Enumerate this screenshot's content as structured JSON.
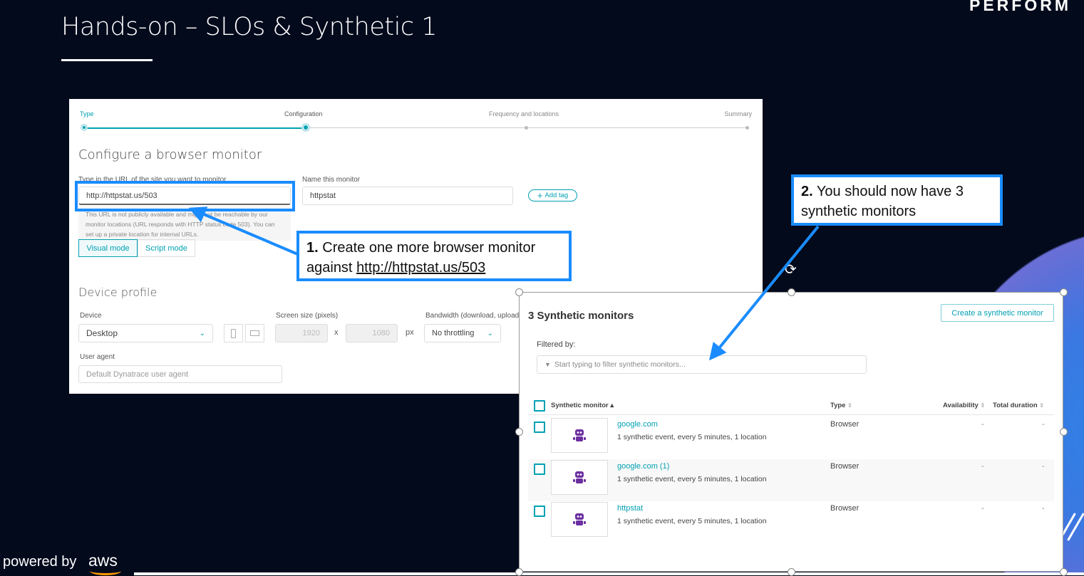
{
  "slide": {
    "title": "Hands-on – SLOs & Synthetic 1",
    "brand": "PERFORM",
    "powered_by": "powered by",
    "aws": "aws"
  },
  "wizard": {
    "steps": [
      {
        "label": "Type",
        "state": "done"
      },
      {
        "label": "Configuration",
        "state": "current"
      },
      {
        "label": "Frequency and locations",
        "state": "pending"
      },
      {
        "label": "Summary",
        "state": "pending"
      }
    ],
    "heading": "Configure a browser monitor",
    "url_label": "Type in the URL of the site you want to monitor",
    "url_value": "http://httpstat.us/503",
    "url_warning": "This URL is not publicly available and might not be reachable by our monitor locations (URL responds with HTTP status code 503). You can set up a private location for internal URLs.",
    "name_label": "Name this monitor",
    "name_value": "httpstat",
    "add_tag": "Add tag",
    "modes": [
      "Visual mode",
      "Script mode"
    ],
    "device_heading": "Device profile",
    "device_label": "Device",
    "device_value": "Desktop",
    "screen_label": "Screen size (pixels)",
    "screen_width": "1920",
    "screen_x": "x",
    "screen_height": "1080",
    "screen_unit": "px",
    "bandwidth_label": "Bandwidth (download, upload",
    "bandwidth_value": "No throttling",
    "ua_label": "User agent",
    "ua_placeholder": "Default Dynatrace user agent"
  },
  "callouts": {
    "one_num": "1.",
    "one_text": "Create one more browser monitor against",
    "one_link": "http://httpstat.us/503",
    "two_num": "2.",
    "two_text": "You should now have 3 synthetic monitors"
  },
  "monitors": {
    "title": "3 Synthetic monitors",
    "create_button": "Create a synthetic monitor",
    "filter_label": "Filtered by:",
    "filter_placeholder": "Start typing to filter synthetic monitors...",
    "columns": [
      "Synthetic monitor ▴",
      "Type",
      "Availability",
      "Total duration"
    ],
    "rows": [
      {
        "name": "google.com",
        "desc": "1 synthetic event, every 5 minutes, 1 location",
        "type": "Browser",
        "availability": "-",
        "duration": "-"
      },
      {
        "name": "google.com (1)",
        "desc": "1 synthetic event, every 5 minutes, 1 location",
        "type": "Browser",
        "availability": "-",
        "duration": "-"
      },
      {
        "name": "httpstat",
        "desc": "1 synthetic event, every 5 minutes, 1 location",
        "type": "Browser",
        "availability": "-",
        "duration": "-"
      }
    ]
  },
  "colors": {
    "background": "#030a1c",
    "accent": "#00a1b2",
    "callout": "#1a8cff",
    "robot": "#6b2fa0"
  }
}
